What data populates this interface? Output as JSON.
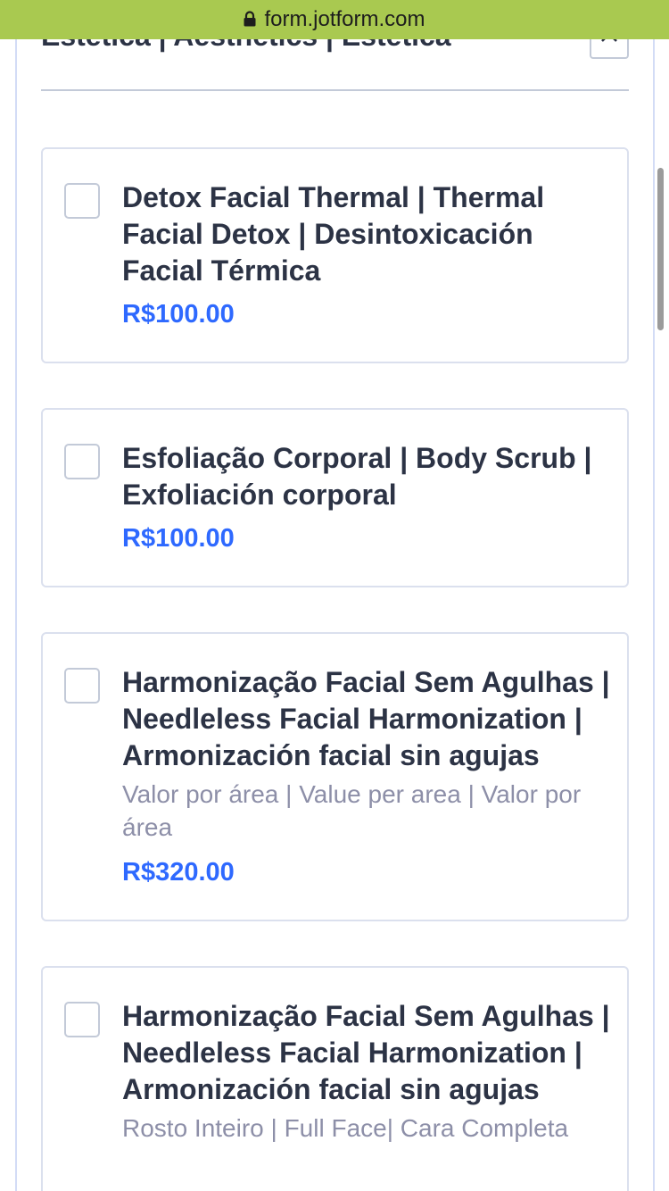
{
  "browser": {
    "url": "form.jotform.com"
  },
  "section": {
    "title": "Estética | Aesthetics | Estética"
  },
  "products": [
    {
      "title": "Detox Facial Thermal | Thermal Facial Detox | Desintoxicación Facial Térmica",
      "description": "",
      "price": "R$100.00"
    },
    {
      "title": "Esfoliação Corporal | Body Scrub | Exfoliación corporal",
      "description": "",
      "price": "R$100.00"
    },
    {
      "title": "Harmonização Facial Sem Agulhas | Needleless Facial Harmonization | Armonización facial sin agujas",
      "description": "Valor por área | Value per area | Valor por área",
      "price": "R$320.00"
    },
    {
      "title": "Harmonização Facial Sem Agulhas | Needleless Facial Harmonization | Armonización facial sin agujas",
      "description": "Rosto Inteiro | Full Face| Cara Completa",
      "price": ""
    }
  ],
  "colors": {
    "url_bar": "#a9c950",
    "price": "#2e69ff",
    "text": "#2c3345",
    "muted": "#8d8fa8"
  }
}
